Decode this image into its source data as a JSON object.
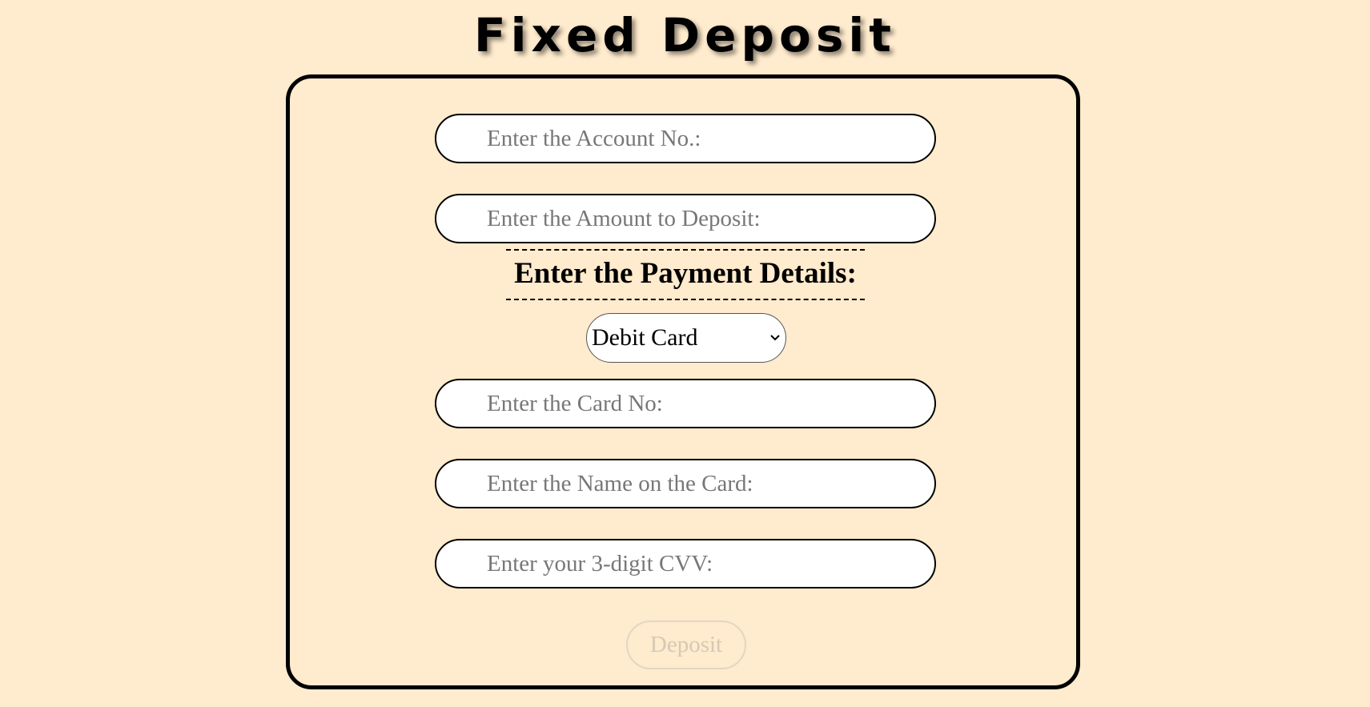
{
  "page": {
    "title": "Fixed Deposit",
    "background_color": "#ffebcd"
  },
  "form": {
    "account_no": {
      "value": "",
      "placeholder": "Enter the Account No.:"
    },
    "amount": {
      "value": "",
      "placeholder": "Enter the Amount to Deposit:"
    },
    "payment_heading": "Enter the Payment Details:",
    "payment_method": {
      "selected": "Debit Card",
      "icon": "chevron-down-icon"
    },
    "card_no": {
      "value": "",
      "placeholder": "Enter the Card No:"
    },
    "card_name": {
      "value": "",
      "placeholder": "Enter the Name on the Card:"
    },
    "cvv": {
      "value": "",
      "placeholder": "Enter your 3-digit CVV:"
    },
    "deposit_label": "Deposit"
  }
}
